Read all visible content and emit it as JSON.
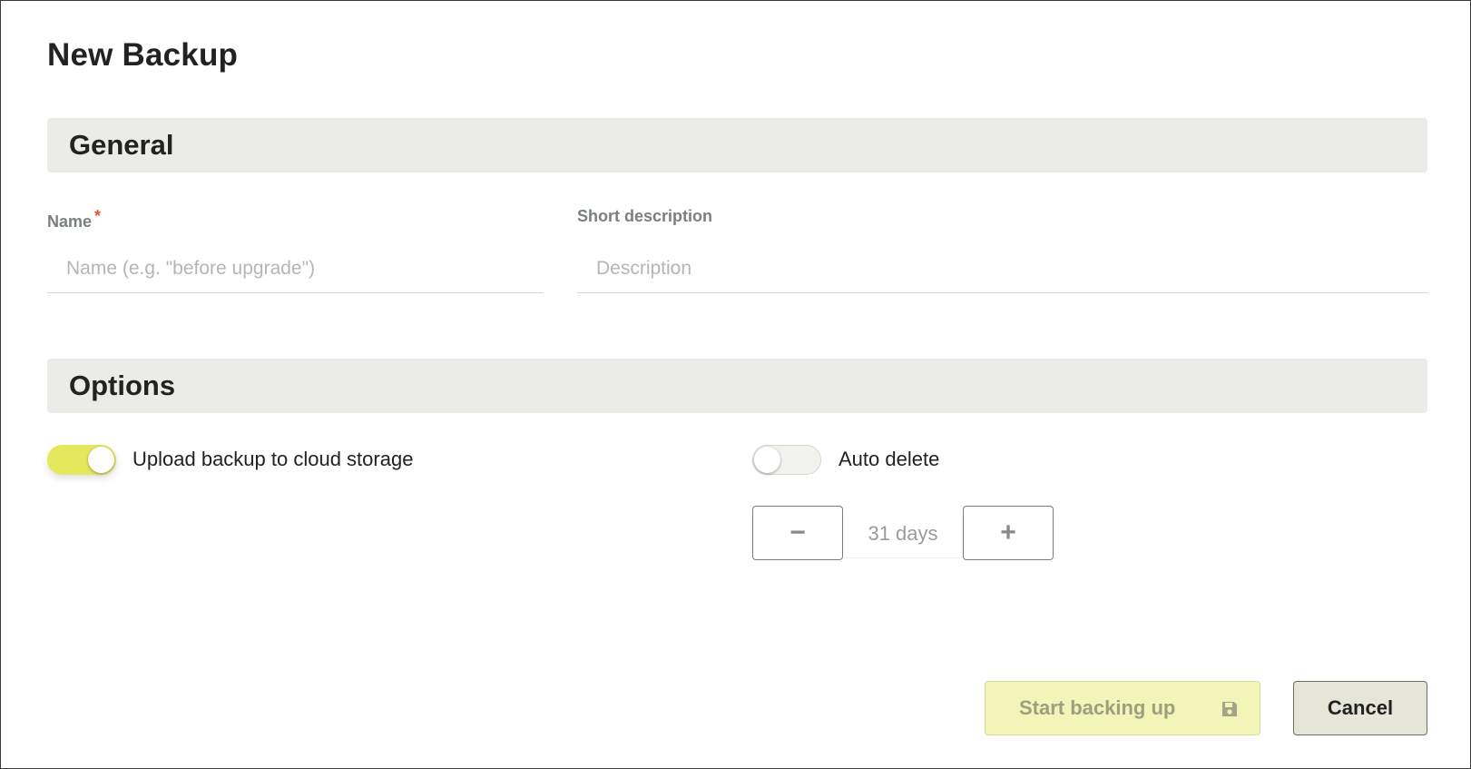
{
  "dialog": {
    "title": "New Backup"
  },
  "general": {
    "header": "General",
    "name_field": {
      "label": "Name",
      "required_marker": "*",
      "value": "",
      "placeholder": "Name (e.g. \"before upgrade\")"
    },
    "description_field": {
      "label": "Short description",
      "value": "",
      "placeholder": "Description"
    }
  },
  "options": {
    "header": "Options",
    "upload_toggle": {
      "label": "Upload backup to cloud storage",
      "state": "on"
    },
    "auto_delete_toggle": {
      "label": "Auto delete",
      "state": "off"
    },
    "retention_stepper": {
      "decrement_label": "−",
      "increment_label": "+",
      "value": "31 days"
    }
  },
  "actions": {
    "start_label": "Start backing up",
    "start_icon": "save-icon",
    "cancel_label": "Cancel"
  },
  "colors": {
    "toggle_on": "#e4e85d",
    "primary_button_disabled": "#f2f4b8",
    "cancel_button": "#e6e6d8",
    "required_marker": "#e2572e",
    "section_header_bg": "#ebebe7"
  }
}
